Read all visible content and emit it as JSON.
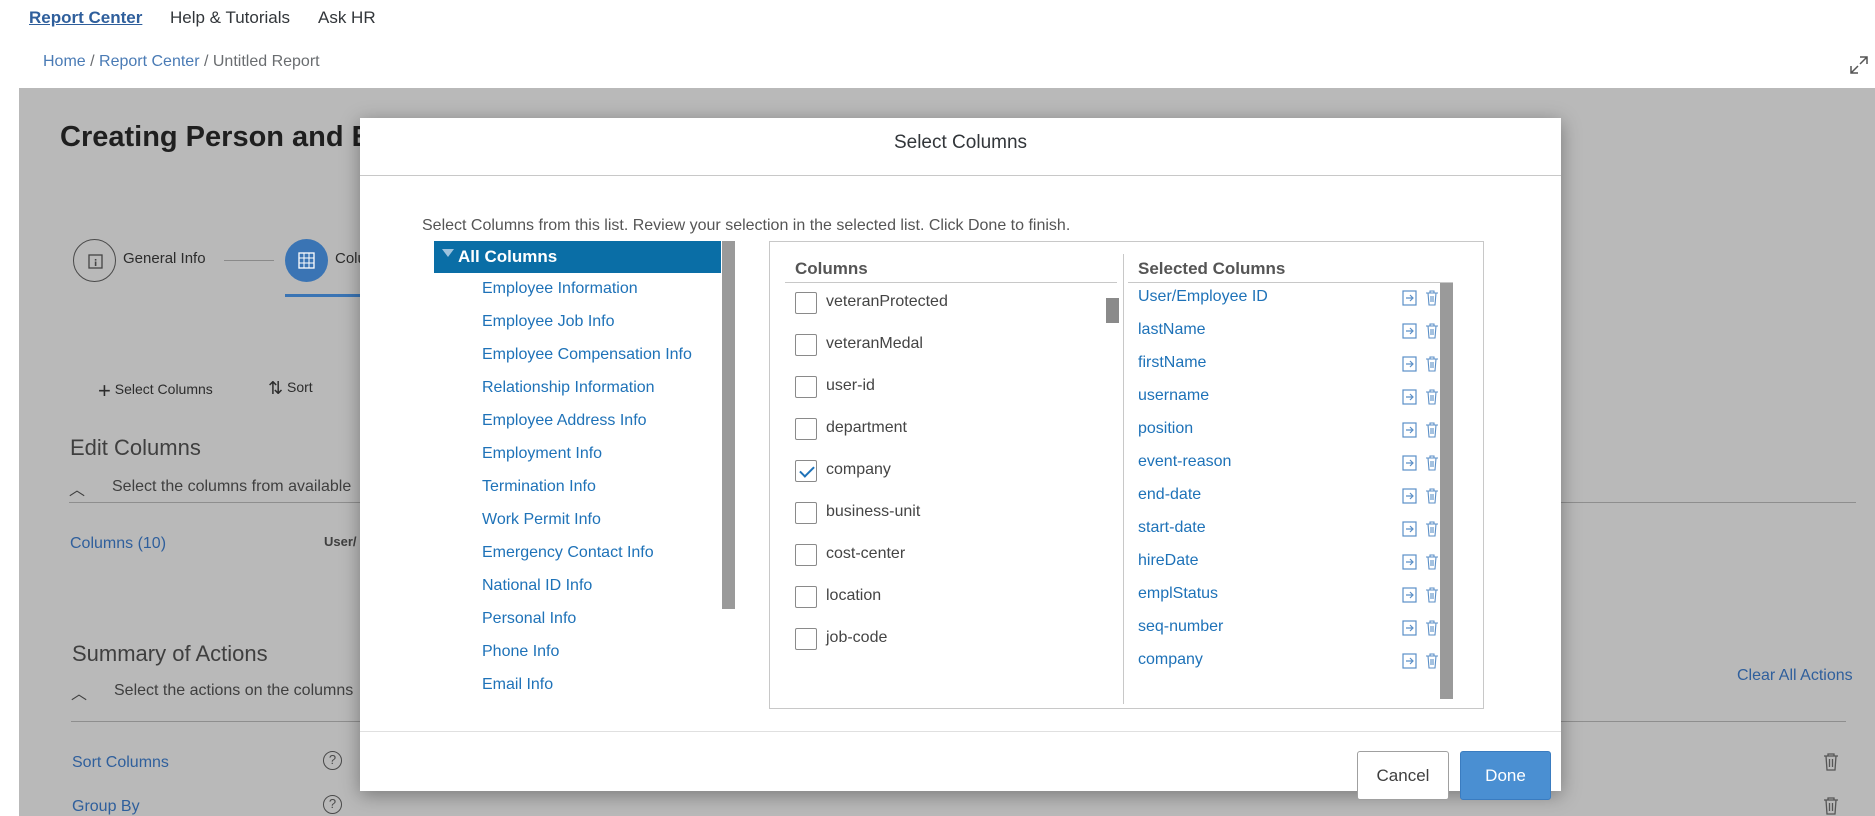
{
  "topnav": {
    "items": [
      {
        "label": "Report Center",
        "active": true
      },
      {
        "label": "Help & Tutorials",
        "active": false
      },
      {
        "label": "Ask HR",
        "active": false
      }
    ]
  },
  "breadcrumb": {
    "home": "Home",
    "sep1": " / ",
    "report_center": "Report Center",
    "sep2": " / ",
    "current": "Untitled Report"
  },
  "background": {
    "title": "Creating Person and E",
    "steps": [
      {
        "label": "General Info",
        "icon": "info-icon"
      },
      {
        "label": "Colu",
        "icon": "table-icon",
        "active": true
      }
    ],
    "toolbar": {
      "select_columns": "Select Columns",
      "sort": "Sort"
    },
    "edit_columns": {
      "title": "Edit Columns",
      "hint": "Select the columns from available",
      "columns_link": "Columns (10)",
      "first_col": "User/"
    },
    "summary": {
      "title": "Summary of Actions",
      "hint": "Select the actions on the columns",
      "clear_all": "Clear All Actions",
      "sort_columns": "Sort Columns",
      "group_by": "Group By",
      "help": "?"
    }
  },
  "dialog": {
    "title": "Select Columns",
    "instructions": "Select Columns from this list. Review your selection in the selected list. Click Done to finish.",
    "tree": {
      "root": "All Columns",
      "items": [
        "Employee Information",
        "Employee Job Info",
        "Employee Compensation Info",
        "Relationship Information",
        "Employee Address Info",
        "Employment Info",
        "Termination Info",
        "Work Permit Info",
        "Emergency Contact Info",
        "National ID Info",
        "Personal Info",
        "Phone Info",
        "Email Info"
      ]
    },
    "columns": {
      "header": "Columns",
      "items": [
        {
          "label": "veteranProtected",
          "checked": false
        },
        {
          "label": "veteranMedal",
          "checked": false
        },
        {
          "label": "user-id",
          "checked": false
        },
        {
          "label": "department",
          "checked": false
        },
        {
          "label": "company",
          "checked": true
        },
        {
          "label": "business-unit",
          "checked": false
        },
        {
          "label": "cost-center",
          "checked": false
        },
        {
          "label": "location",
          "checked": false
        },
        {
          "label": "job-code",
          "checked": false
        }
      ]
    },
    "selected": {
      "header": "Selected Columns",
      "items": [
        "User/Employee ID",
        "lastName",
        "firstName",
        "username",
        "position",
        "event-reason",
        "end-date",
        "start-date",
        "hireDate",
        "emplStatus",
        "seq-number",
        "company"
      ]
    },
    "buttons": {
      "cancel": "Cancel",
      "done": "Done"
    }
  },
  "colors": {
    "accent": "#0a6ea6",
    "link": "#1e72b8",
    "primary_button": "#4a8fd2",
    "backdrop": "#b9b9b9"
  }
}
